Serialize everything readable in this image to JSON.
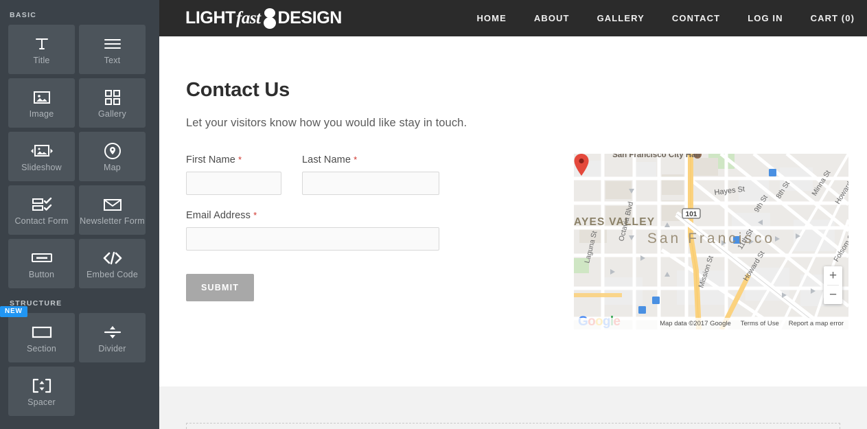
{
  "sidebar": {
    "groups": [
      {
        "label": "BASIC",
        "tiles": [
          {
            "label": "Title",
            "icon": "title-icon"
          },
          {
            "label": "Text",
            "icon": "text-lines-icon"
          },
          {
            "label": "Image",
            "icon": "image-icon"
          },
          {
            "label": "Gallery",
            "icon": "gallery-grid-icon"
          },
          {
            "label": "Slideshow",
            "icon": "slideshow-icon"
          },
          {
            "label": "Map",
            "icon": "map-pin-circle-icon"
          },
          {
            "label": "Contact Form",
            "icon": "contact-form-icon"
          },
          {
            "label": "Newsletter Form",
            "icon": "envelope-icon"
          },
          {
            "label": "Button",
            "icon": "button-icon"
          },
          {
            "label": "Embed Code",
            "icon": "code-brackets-icon"
          }
        ]
      },
      {
        "label": "STRUCTURE",
        "tiles": [
          {
            "label": "Section",
            "icon": "section-rect-icon",
            "badge": "NEW"
          },
          {
            "label": "Divider",
            "icon": "divider-icon"
          },
          {
            "label": "Spacer",
            "icon": "spacer-icon"
          }
        ]
      }
    ]
  },
  "header": {
    "logo": {
      "part1": "LIGHT",
      "part2": "fast",
      "mark": "hourglass-bulb-mark",
      "part3": "DESIGN"
    },
    "nav": [
      {
        "label": "HOME"
      },
      {
        "label": "ABOUT"
      },
      {
        "label": "GALLERY"
      },
      {
        "label": "CONTACT"
      },
      {
        "label": "LOG IN"
      },
      {
        "label": "CART (0)"
      }
    ]
  },
  "content": {
    "title": "Contact Us",
    "subtitle": "Let your visitors know how you would like stay in touch.",
    "form": {
      "first_name": {
        "label": "First Name",
        "required_mark": "*",
        "value": "",
        "placeholder": ""
      },
      "last_name": {
        "label": "Last Name",
        "required_mark": "*",
        "value": "",
        "placeholder": ""
      },
      "email": {
        "label": "Email Address",
        "required_mark": "*",
        "value": "",
        "placeholder": ""
      },
      "submit_label": "SUBMIT"
    }
  },
  "map": {
    "city_label": "San Francisco",
    "neighborhood_label": "AYES VALLEY",
    "poi_label": "San Francisco City Hall",
    "highway_shield": "101",
    "streets": [
      "Hayes St",
      "8th St",
      "9th St",
      "Minna St",
      "Howard St",
      "Folsom St",
      "11th St",
      "Mission St",
      "Octavia Blvd",
      "Laguna St"
    ],
    "attribution": {
      "google_logo": "Google",
      "data": "Map data ©2017 Google",
      "terms": "Terms of Use",
      "report": "Report a map error"
    },
    "zoom_in": "+",
    "zoom_out": "−"
  },
  "colors": {
    "sidebar_bg": "#3b4249",
    "tile_bg": "#4c545b",
    "site_header_bg": "#2b2b2b",
    "badge_blue": "#2196f3",
    "required_red": "#d0342c",
    "submit_gray": "#a8a8a8",
    "pin_red": "#e4493c"
  }
}
